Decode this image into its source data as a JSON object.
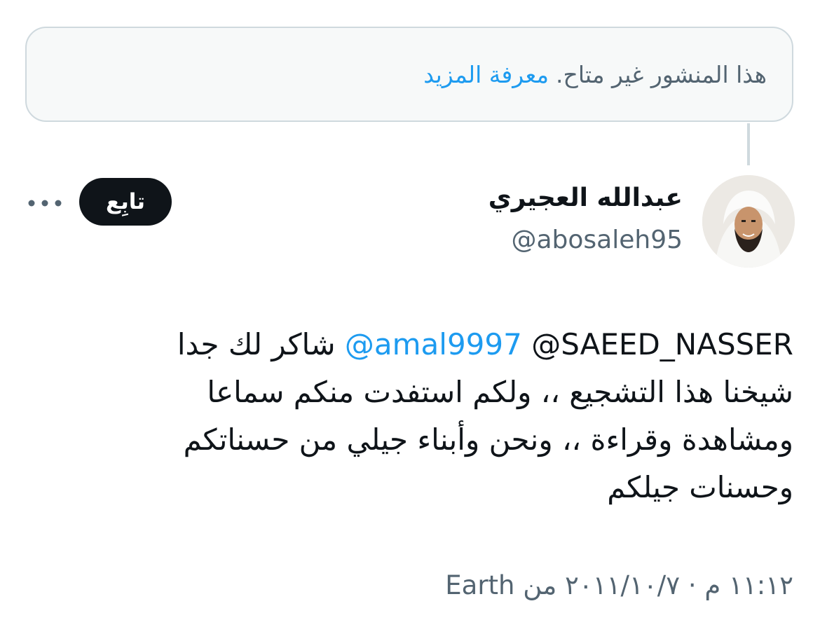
{
  "notice": {
    "text": "هذا المنشور غير متاح.",
    "link": "معرفة المزيد"
  },
  "author": {
    "name": "عبدالله العجيري",
    "handle": "@abosaleh95"
  },
  "actions": {
    "follow_label": "تابِع"
  },
  "tweet": {
    "line1_prefix": "@SAEED_NASSER",
    "mention": "@amal9997",
    "line1_suffix": "شاكر لك جدا",
    "line2": "شيخنا هذا التشجيع ،، ولكم استفدت منكم سماعا",
    "line3": "ومشاهدة وقراءة ،، ونحن وأبناء جيلي من حسناتكم",
    "line4": "وحسنات جيلكم"
  },
  "meta": {
    "timestamp": "١١:١٢ م · ٢٠١١/١٠/٧",
    "source_prefix": "من",
    "source": "Earth"
  },
  "colors": {
    "link": "#1d9bf0",
    "muted": "#536471",
    "text": "#0f1419",
    "button_bg": "#0f1419"
  }
}
